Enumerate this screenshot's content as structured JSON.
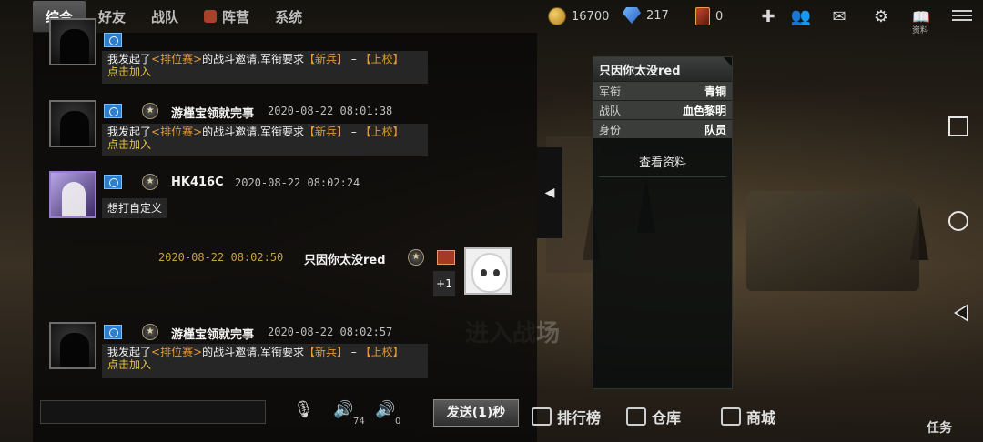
{
  "tabs": [
    {
      "label": "综合",
      "active": true
    },
    {
      "label": "好友",
      "active": false
    },
    {
      "label": "战队",
      "active": false
    },
    {
      "label": "阵营",
      "active": false
    },
    {
      "label": "系统",
      "active": false
    }
  ],
  "resources": {
    "gold": "16700",
    "diamond": "217",
    "card": "0"
  },
  "top_icons": [
    "add-icon",
    "friends-icon",
    "mail-icon",
    "settings-icon",
    "book-icon",
    "menu-icon"
  ],
  "top_icon_labels": {
    "book": "资料"
  },
  "messages": [
    {
      "name": "游槿宝领就完事",
      "time": "2020-08-22 08:01:38",
      "line1_prefix": "我发起了",
      "line1_mode": "<排位赛>",
      "line1_mid": "的战斗邀请,军衔要求",
      "line1_rank_low": "【新兵】",
      "line1_dash": " – ",
      "line1_rank_high": "【上校】",
      "join": "点击加入"
    },
    {
      "name": "HK416C",
      "time": "2020-08-22 08:02:24",
      "text": "想打自定义"
    },
    {
      "name": "只因你太没red",
      "time": "2020-08-22 08:02:50",
      "plus": "+1"
    },
    {
      "name": "游槿宝领就完事",
      "time": "2020-08-22 08:02:57",
      "line1_prefix": "我发起了",
      "line1_mode": "<排位赛>",
      "line1_mid": "的战斗邀请,军衔要求",
      "line1_rank_low": "【新兵】",
      "line1_dash": " – ",
      "line1_rank_high": "【上校】",
      "join": "点击加入"
    }
  ],
  "partial_message": {
    "line1_prefix": "我发起了",
    "line1_mode": "<排位赛>",
    "line1_mid": "的战斗邀请,军衔要求",
    "line1_rank_low": "【新兵】",
    "line1_dash": " – ",
    "line1_rank_high": "【上校】",
    "join": "点击加入"
  },
  "input": {
    "placeholder": "",
    "value": ""
  },
  "voice": {
    "speaker_count": "74",
    "mic_count": "0"
  },
  "send_label": "发送(1)秒",
  "profile": {
    "name": "只因你太没red",
    "rows": [
      {
        "key": "军衔",
        "value": "青铜"
      },
      {
        "key": "战队",
        "value": "血色黎明"
      },
      {
        "key": "身份",
        "value": "队员"
      }
    ],
    "view_label": "查看资料"
  },
  "bottom_menu": [
    {
      "label": "排行榜"
    },
    {
      "label": "仓库"
    },
    {
      "label": "商城"
    }
  ],
  "battle_label": "进入战场",
  "task_label": "任务",
  "collapse_arrow": "◀",
  "colors": {
    "link": "#e6c23a",
    "highlight": "#e39a3a",
    "time_self": "#c8a040"
  }
}
